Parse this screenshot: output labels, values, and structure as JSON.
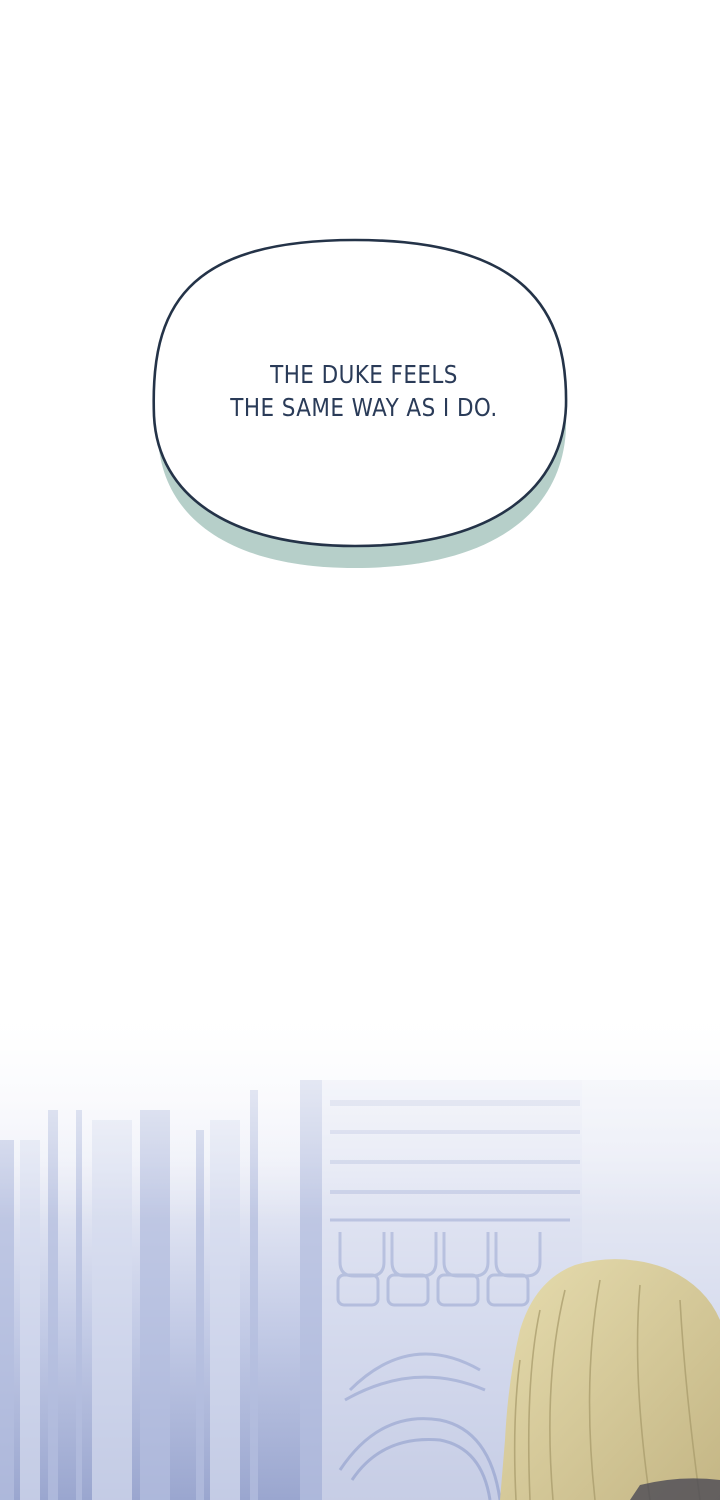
{
  "bubble": {
    "lines": [
      "THE DUKE FEELS",
      "THE SAME WAY AS I DO."
    ]
  },
  "colors": {
    "background": "#ffffff",
    "bubble_outline": "#243348",
    "bubble_shadow": "#b6cfc9",
    "text": "#2a3b58",
    "hair": "#d2c596",
    "room_tint": "#8d9bc6"
  },
  "icons": []
}
